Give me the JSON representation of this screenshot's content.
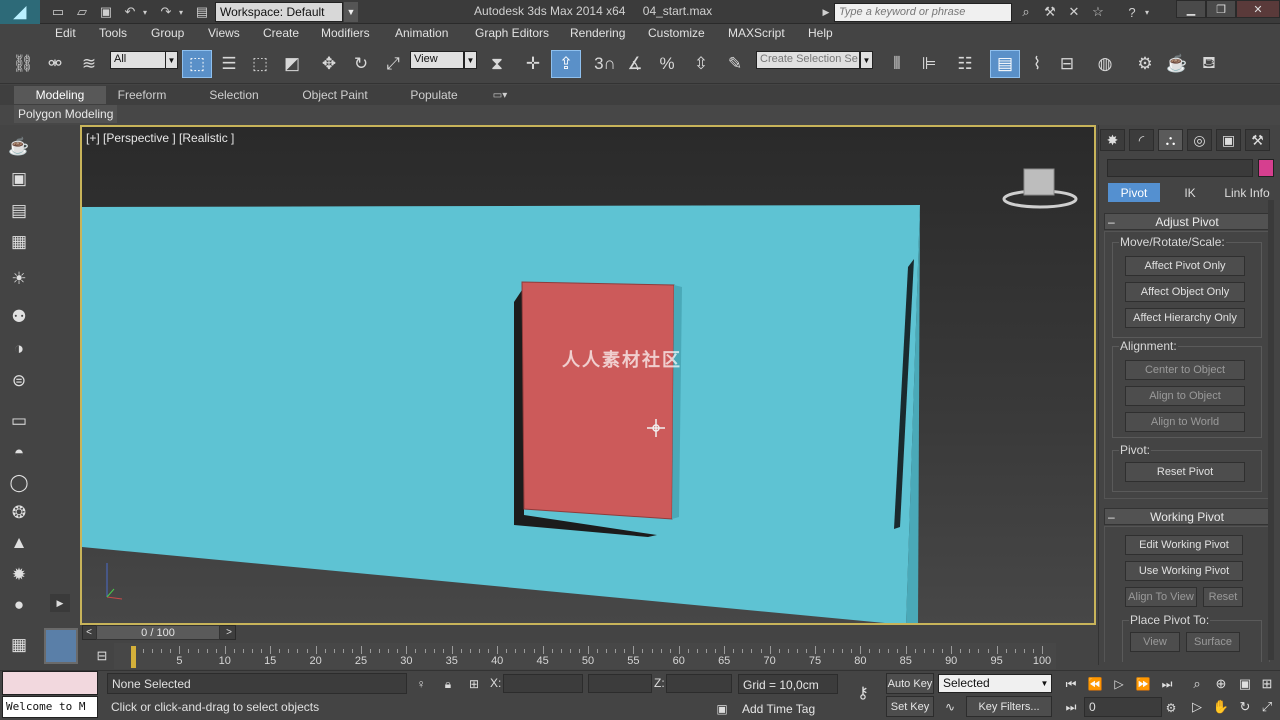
{
  "title_bar": {
    "workspace": "Workspace: Default",
    "app_title": "Autodesk 3ds Max  2014 x64",
    "file_name": "04_start.max",
    "search_placeholder": "Type a keyword or phrase"
  },
  "menu": [
    "Edit",
    "Tools",
    "Group",
    "Views",
    "Create",
    "Modifiers",
    "Animation",
    "Graph Editors",
    "Rendering",
    "Customize",
    "MAXScript",
    "Help"
  ],
  "main_toolbar": {
    "selection_filter": "All",
    "ref_coord": "View",
    "snap_3": "3",
    "named_selection_placeholder": "Create Selection Se"
  },
  "ribbon": {
    "tabs": [
      "Modeling",
      "Freeform",
      "Selection",
      "Object Paint",
      "Populate"
    ],
    "active_tab": "Modeling",
    "panel_label": "Polygon Modeling"
  },
  "viewport": {
    "label": "[+] [Perspective ] [Realistic ]",
    "watermark": "人人素材社区",
    "colors": {
      "box": "#5fc4d4",
      "door": "#cc5a5a"
    }
  },
  "command_panel": {
    "subtabs": [
      "Pivot",
      "IK",
      "Link Info"
    ],
    "active_subtab": "Pivot",
    "adjust_pivot": {
      "header": "Adjust Pivot",
      "move_rotate_scale_label": "Move/Rotate/Scale:",
      "buttons": [
        "Affect Pivot Only",
        "Affect Object Only",
        "Affect Hierarchy Only"
      ],
      "alignment_label": "Alignment:",
      "alignment_buttons": [
        "Center to Object",
        "Align to Object",
        "Align to World"
      ],
      "pivot_label": "Pivot:",
      "reset_pivot": "Reset Pivot"
    },
    "working_pivot": {
      "header": "Working Pivot",
      "edit": "Edit Working Pivot",
      "use": "Use Working Pivot",
      "align_to_view": "Align To View",
      "reset": "Reset",
      "place_pivot_label": "Place Pivot To:",
      "view": "View",
      "surface": "Surface"
    }
  },
  "timeline": {
    "frame_display": "0 / 100",
    "ticks": [
      "5",
      "10",
      "15",
      "20",
      "25",
      "30",
      "35",
      "40",
      "45",
      "50",
      "55",
      "60",
      "65",
      "70",
      "75",
      "80",
      "85",
      "90",
      "95",
      "100"
    ]
  },
  "status": {
    "maxscript_text": "Welcome to M",
    "selection": "None Selected",
    "prompt": "Click or click-and-drag to select objects",
    "x_label": "X:",
    "z_label": "Z:",
    "grid": "Grid = 10,0cm",
    "add_time_tag": "Add Time Tag",
    "auto_key": "Auto Key",
    "set_key": "Set Key",
    "selected_option": "Selected",
    "key_filters": "Key Filters...",
    "frame_value": "0"
  }
}
